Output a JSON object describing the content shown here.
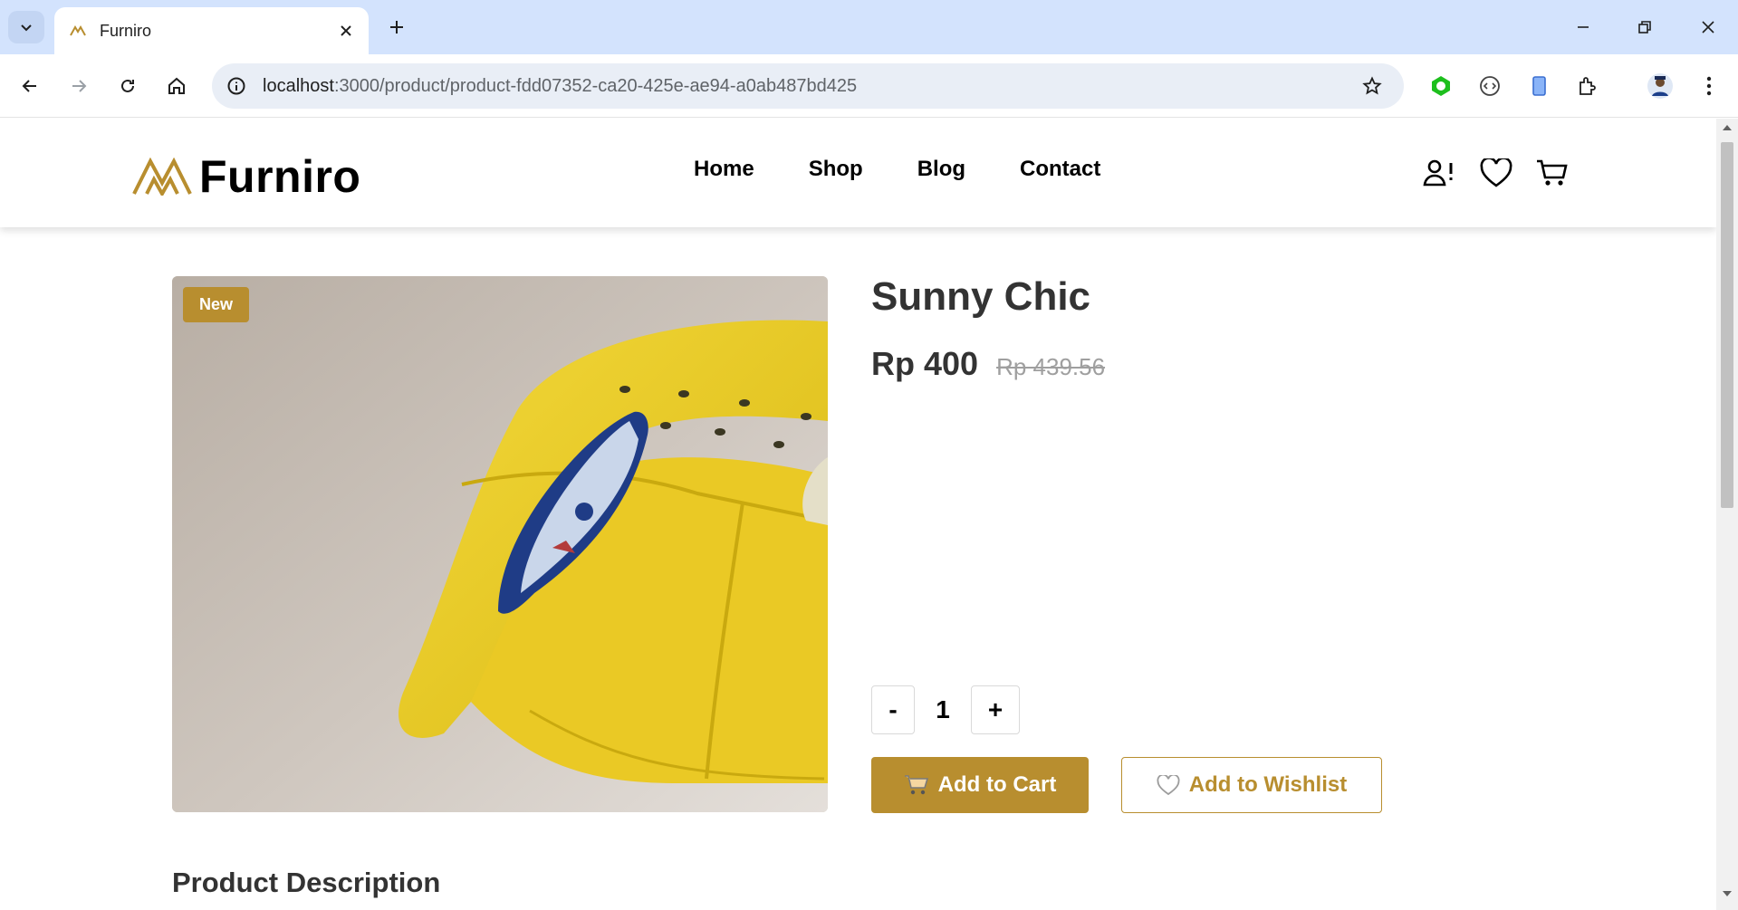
{
  "browser": {
    "tab": {
      "title": "Furniro",
      "close_icon": "close-icon"
    },
    "url": {
      "host": "localhost",
      "rest": ":3000/product/product-fdd07352-ca20-425e-ae94-a0ab487bd425"
    }
  },
  "site": {
    "logo_text": "Furniro",
    "nav": [
      "Home",
      "Shop",
      "Blog",
      "Contact"
    ],
    "accent_color": "#b88e2f"
  },
  "product": {
    "badge": "New",
    "title": "Sunny Chic",
    "price": "Rp 400",
    "old_price": "Rp 439.56",
    "quantity": {
      "decrement_label": "-",
      "value": "1",
      "increment_label": "+"
    },
    "add_to_cart_label": "Add to Cart",
    "add_to_wishlist_label": "Add to Wishlist",
    "description_heading": "Product Description"
  }
}
